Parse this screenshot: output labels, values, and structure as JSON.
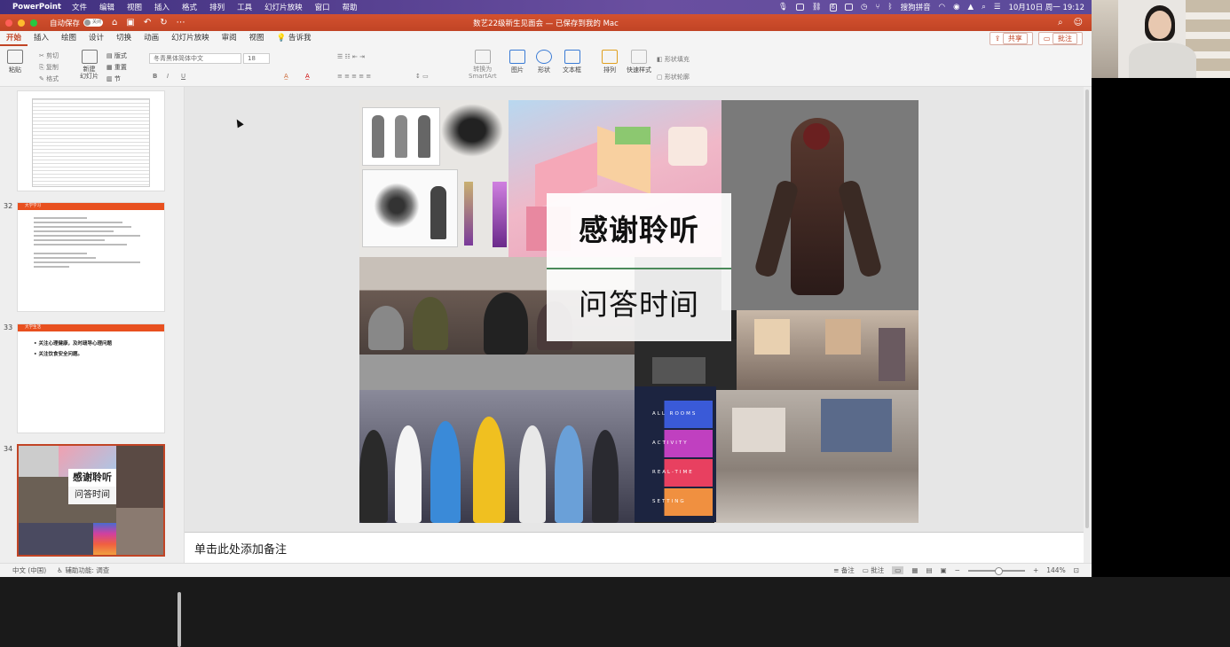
{
  "menubar": {
    "app": "PowerPoint",
    "items": [
      "文件",
      "编辑",
      "视图",
      "插入",
      "格式",
      "排列",
      "工具",
      "幻灯片放映",
      "窗口",
      "帮助"
    ],
    "datetime": "10月10日 周一 19:12",
    "input_method": "搜狗拼音",
    "badge": "6"
  },
  "titlebar": {
    "autosave_label": "自动保存",
    "autosave_state": "关闭",
    "doc_title": "数艺22级新生见面会 — 已保存到我的 Mac"
  },
  "ribbon_tabs": {
    "tabs": [
      "开始",
      "插入",
      "绘图",
      "设计",
      "切换",
      "动画",
      "幻灯片放映",
      "审阅",
      "视图"
    ],
    "tell_me": "告诉我",
    "share": "共享",
    "comments": "批注"
  },
  "ribbon": {
    "paste": "粘贴",
    "cut": "剪切",
    "copy": "复制",
    "format": "格式",
    "new_slide": "新建\n幻灯片",
    "layout": "版式",
    "reset": "重置",
    "section": "节",
    "font_name": "冬青黑体简体中文",
    "font_size": "18",
    "convert_smartart": "转换为\nSmartArt",
    "picture": "图片",
    "shape": "形状",
    "textbox": "文本框",
    "arrange": "排列",
    "quick_styles": "快速样式",
    "shape_fill": "形状填充",
    "shape_outline": "形状轮廓"
  },
  "thumbnails": [
    {
      "num": "32",
      "header": "大学学习"
    },
    {
      "num": "33",
      "header": "大学生活",
      "lines": [
        "关注心理健康，及时疏导心理问题",
        "关注饮食安全问题。"
      ]
    },
    {
      "num": "34",
      "title": "感谢聆听",
      "subtitle": "问答时间"
    }
  ],
  "slide": {
    "title": "感谢聆听",
    "subtitle": "问答时间",
    "rooms": [
      "ALL ROOMS",
      "ACTIVITY",
      "REAL-TIME",
      "SETTING"
    ]
  },
  "notes": {
    "placeholder": "单击此处添加备注"
  },
  "status": {
    "language": "中文 (中国)",
    "accessibility": "辅助功能: 调查",
    "notes_btn": "备注",
    "comments_btn": "批注",
    "zoom": "144%"
  },
  "colors": {
    "accent": "#c14425",
    "menubar": "#4a3a8a",
    "orange": "#e8501f"
  }
}
